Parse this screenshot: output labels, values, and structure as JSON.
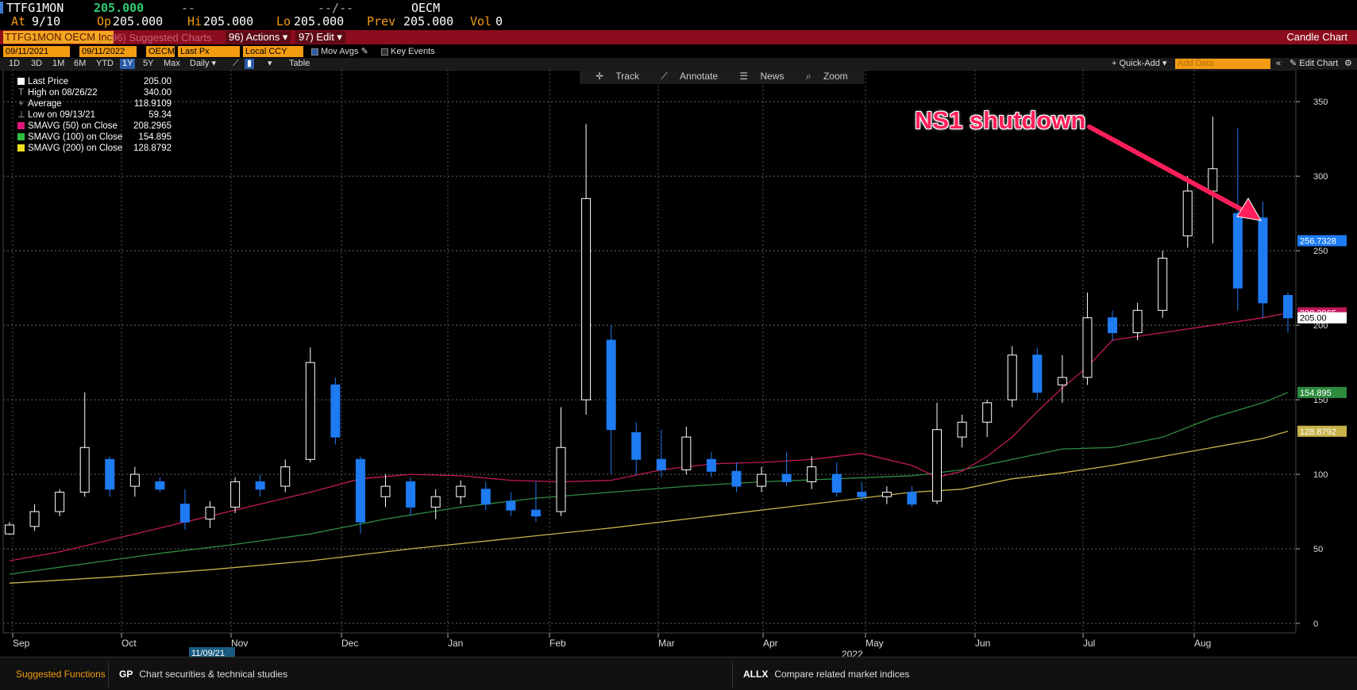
{
  "quote": {
    "ticker": "TTFG1MON",
    "last": "205.000",
    "change": "--",
    "change_pct": "--/--",
    "exchange": "OECM",
    "at_label": "At",
    "at_value": "9/10",
    "op_label": "Op",
    "op_value": "205.000",
    "hi_label": "Hi",
    "hi_value": "205.000",
    "lo_label": "Lo",
    "lo_value": "205.000",
    "prev_label": "Prev",
    "prev_value": "205.000",
    "vol_label": "Vol",
    "vol_value": "0"
  },
  "toolbar": {
    "security": "TTFG1MON OECM Inc",
    "suggested": "96) Suggested Charts",
    "actions": "96) Actions ▾",
    "edit": "97) Edit ▾",
    "chart_type": "Candle Chart"
  },
  "controls": {
    "start_date": "09/11/2021",
    "end_date": "09/11/2022",
    "source": "OECM",
    "field": "Last Px",
    "currency": "Local CCY",
    "mov_avgs": "Mov Avgs",
    "key_events": "Key Events"
  },
  "ranges": [
    "1D",
    "3D",
    "1M",
    "6M",
    "YTD",
    "1Y",
    "5Y",
    "Max"
  ],
  "active_range": "1Y",
  "period": "Daily ▾",
  "table_label": "Table",
  "quick_add": "+ Quick-Add ▾",
  "add_data_placeholder": "Add Data",
  "edit_chart": "Edit Chart",
  "tools": [
    "Track",
    "Annotate",
    "News",
    "Zoom"
  ],
  "legend": [
    {
      "label": "Last Price",
      "value": "205.00",
      "swatch": "#ffffff"
    },
    {
      "label": "High on 08/26/22",
      "value": "340.00",
      "icon": "T"
    },
    {
      "label": "Average",
      "value": "118.9109",
      "icon": "+"
    },
    {
      "label": "Low on 09/13/21",
      "value": "59.34",
      "icon": "⊥"
    },
    {
      "label": "SMAVG (50)   on Close",
      "value": "208.2965",
      "swatch": "#e0177d"
    },
    {
      "label": "SMAVG (100)  on Close",
      "value": "154.895",
      "swatch": "#2ebd3f"
    },
    {
      "label": "SMAVG (200)  on Close",
      "value": "128.8792",
      "swatch": "#f0e020"
    }
  ],
  "annotation": "NS1 shutdown",
  "bottom": {
    "suggested_functions": "Suggested Functions",
    "gp_tag": "GP",
    "gp_desc": "Chart securities & technical studies",
    "allx_tag": "ALLX",
    "allx_desc": "Compare related market indices"
  },
  "colors": {
    "up": "#ffffff",
    "down": "#1e7bf2",
    "sma50": "#c2185b",
    "sma100": "#2e8b3e",
    "sma200": "#c9b24a",
    "accent_amber": "#f39c12",
    "toolbar_red": "#8c0d1d"
  },
  "chart_data": {
    "type": "candlestick",
    "title": "",
    "y_axis": {
      "ticks": [
        0,
        50,
        100,
        150,
        200,
        250,
        300,
        350
      ],
      "range": [
        0,
        365
      ],
      "side": "right",
      "grid": true
    },
    "x_axis": {
      "months": [
        "Sep",
        "Oct",
        "Nov",
        "Dec",
        "Jan",
        "Feb",
        "Mar",
        "Apr",
        "May",
        "Jun",
        "Jul",
        "Aug"
      ],
      "year_label": "2022",
      "cursor_date": "11/09/21"
    },
    "price_tags": [
      {
        "value": 256.7328,
        "label": "256.7328",
        "color": "#1e7bf2"
      },
      {
        "value": 208.2965,
        "label": "208.2965",
        "color": "#c2185b"
      },
      {
        "value": 205.0,
        "label": "205.00",
        "color": "#ffffff"
      },
      {
        "value": 154.895,
        "label": "154.895",
        "color": "#2e8b3e"
      },
      {
        "value": 128.8792,
        "label": "128.8792",
        "color": "#c9b24a"
      }
    ],
    "candles": [
      {
        "d": "2021-09-13",
        "o": 60,
        "h": 68,
        "l": 59.34,
        "c": 66
      },
      {
        "d": "2021-09-20",
        "o": 65,
        "h": 80,
        "l": 62,
        "c": 75
      },
      {
        "d": "2021-09-27",
        "o": 75,
        "h": 90,
        "l": 72,
        "c": 88
      },
      {
        "d": "2021-10-04",
        "o": 88,
        "h": 155,
        "l": 85,
        "c": 118
      },
      {
        "d": "2021-10-11",
        "o": 110,
        "h": 112,
        "l": 85,
        "c": 90
      },
      {
        "d": "2021-10-18",
        "o": 92,
        "h": 105,
        "l": 85,
        "c": 100
      },
      {
        "d": "2021-10-25",
        "o": 95,
        "h": 98,
        "l": 88,
        "c": 90
      },
      {
        "d": "2021-11-01",
        "o": 80,
        "h": 90,
        "l": 63,
        "c": 68
      },
      {
        "d": "2021-11-08",
        "o": 70,
        "h": 82,
        "l": 64,
        "c": 78
      },
      {
        "d": "2021-11-15",
        "o": 78,
        "h": 98,
        "l": 74,
        "c": 95
      },
      {
        "d": "2021-11-22",
        "o": 95,
        "h": 100,
        "l": 85,
        "c": 90
      },
      {
        "d": "2021-11-29",
        "o": 92,
        "h": 110,
        "l": 88,
        "c": 105
      },
      {
        "d": "2021-12-06",
        "o": 110,
        "h": 185,
        "l": 108,
        "c": 175
      },
      {
        "d": "2021-12-13",
        "o": 160,
        "h": 165,
        "l": 120,
        "c": 125
      },
      {
        "d": "2021-12-20",
        "o": 110,
        "h": 112,
        "l": 60,
        "c": 68
      },
      {
        "d": "2021-12-27",
        "o": 85,
        "h": 100,
        "l": 78,
        "c": 92
      },
      {
        "d": "2022-01-03",
        "o": 95,
        "h": 98,
        "l": 72,
        "c": 78
      },
      {
        "d": "2022-01-10",
        "o": 78,
        "h": 90,
        "l": 70,
        "c": 85
      },
      {
        "d": "2022-01-17",
        "o": 85,
        "h": 96,
        "l": 80,
        "c": 92
      },
      {
        "d": "2022-01-24",
        "o": 90,
        "h": 95,
        "l": 76,
        "c": 80
      },
      {
        "d": "2022-01-31",
        "o": 82,
        "h": 88,
        "l": 72,
        "c": 76
      },
      {
        "d": "2022-02-07",
        "o": 76,
        "h": 95,
        "l": 68,
        "c": 72
      },
      {
        "d": "2022-02-14",
        "o": 75,
        "h": 145,
        "l": 72,
        "c": 118
      },
      {
        "d": "2022-02-21",
        "o": 150,
        "h": 335,
        "l": 140,
        "c": 285
      },
      {
        "d": "2022-02-28",
        "o": 190,
        "h": 200,
        "l": 100,
        "c": 130
      },
      {
        "d": "2022-03-07",
        "o": 128,
        "h": 135,
        "l": 100,
        "c": 110
      },
      {
        "d": "2022-03-14",
        "o": 110,
        "h": 130,
        "l": 98,
        "c": 103
      },
      {
        "d": "2022-03-21",
        "o": 103,
        "h": 132,
        "l": 100,
        "c": 125
      },
      {
        "d": "2022-03-28",
        "o": 110,
        "h": 115,
        "l": 98,
        "c": 102
      },
      {
        "d": "2022-04-04",
        "o": 102,
        "h": 108,
        "l": 88,
        "c": 92
      },
      {
        "d": "2022-04-11",
        "o": 92,
        "h": 105,
        "l": 88,
        "c": 100
      },
      {
        "d": "2022-04-18",
        "o": 100,
        "h": 115,
        "l": 92,
        "c": 95
      },
      {
        "d": "2022-04-25",
        "o": 95,
        "h": 112,
        "l": 90,
        "c": 105
      },
      {
        "d": "2022-05-02",
        "o": 100,
        "h": 108,
        "l": 85,
        "c": 88
      },
      {
        "d": "2022-05-09",
        "o": 88,
        "h": 95,
        "l": 82,
        "c": 85
      },
      {
        "d": "2022-05-16",
        "o": 85,
        "h": 92,
        "l": 80,
        "c": 88
      },
      {
        "d": "2022-05-23",
        "o": 88,
        "h": 92,
        "l": 78,
        "c": 80
      },
      {
        "d": "2022-05-30",
        "o": 82,
        "h": 148,
        "l": 80,
        "c": 130
      },
      {
        "d": "2022-06-06",
        "o": 125,
        "h": 140,
        "l": 118,
        "c": 135
      },
      {
        "d": "2022-06-13",
        "o": 135,
        "h": 150,
        "l": 125,
        "c": 148
      },
      {
        "d": "2022-06-20",
        "o": 150,
        "h": 186,
        "l": 145,
        "c": 180
      },
      {
        "d": "2022-06-27",
        "o": 180,
        "h": 185,
        "l": 150,
        "c": 155
      },
      {
        "d": "2022-07-04",
        "o": 160,
        "h": 180,
        "l": 148,
        "c": 165
      },
      {
        "d": "2022-07-11",
        "o": 165,
        "h": 222,
        "l": 160,
        "c": 205
      },
      {
        "d": "2022-07-18",
        "o": 205,
        "h": 210,
        "l": 190,
        "c": 195
      },
      {
        "d": "2022-07-25",
        "o": 195,
        "h": 215,
        "l": 190,
        "c": 210
      },
      {
        "d": "2022-08-01",
        "o": 210,
        "h": 250,
        "l": 205,
        "c": 245
      },
      {
        "d": "2022-08-08",
        "o": 260,
        "h": 300,
        "l": 252,
        "c": 290
      },
      {
        "d": "2022-08-15",
        "o": 290,
        "h": 340,
        "l": 255,
        "c": 305
      },
      {
        "d": "2022-08-22",
        "o": 275,
        "h": 332,
        "l": 210,
        "c": 225
      },
      {
        "d": "2022-08-29",
        "o": 272,
        "h": 283,
        "l": 205,
        "c": 215
      },
      {
        "d": "2022-09-05",
        "o": 220,
        "h": 222,
        "l": 195,
        "c": 205
      }
    ],
    "sma50": [
      [
        0,
        42
      ],
      [
        2,
        48
      ],
      [
        4,
        56
      ],
      [
        6,
        64
      ],
      [
        8,
        72
      ],
      [
        10,
        80
      ],
      [
        12,
        88
      ],
      [
        14,
        97
      ],
      [
        16,
        100
      ],
      [
        18,
        99
      ],
      [
        20,
        96
      ],
      [
        22,
        95
      ],
      [
        24,
        96
      ],
      [
        26,
        103
      ],
      [
        28,
        107
      ],
      [
        30,
        108
      ],
      [
        32,
        110
      ],
      [
        34,
        114
      ],
      [
        36,
        106
      ],
      [
        37,
        98
      ],
      [
        38,
        102
      ],
      [
        39,
        112
      ],
      [
        40,
        125
      ],
      [
        41,
        142
      ],
      [
        42,
        158
      ],
      [
        43,
        172
      ],
      [
        44,
        190
      ],
      [
        46,
        195
      ],
      [
        48,
        200
      ],
      [
        50,
        205
      ],
      [
        51,
        208.2965
      ]
    ],
    "sma100": [
      [
        0,
        33
      ],
      [
        3,
        40
      ],
      [
        6,
        47
      ],
      [
        9,
        53
      ],
      [
        12,
        60
      ],
      [
        15,
        70
      ],
      [
        18,
        78
      ],
      [
        21,
        84
      ],
      [
        24,
        88
      ],
      [
        27,
        92
      ],
      [
        30,
        95
      ],
      [
        33,
        97
      ],
      [
        36,
        99
      ],
      [
        38,
        103
      ],
      [
        40,
        110
      ],
      [
        42,
        117
      ],
      [
        44,
        118
      ],
      [
        46,
        125
      ],
      [
        48,
        138
      ],
      [
        50,
        148
      ],
      [
        51,
        154.895
      ]
    ],
    "sma200": [
      [
        0,
        27
      ],
      [
        4,
        31
      ],
      [
        8,
        36
      ],
      [
        12,
        42
      ],
      [
        16,
        50
      ],
      [
        20,
        57
      ],
      [
        24,
        64
      ],
      [
        28,
        72
      ],
      [
        32,
        80
      ],
      [
        36,
        88
      ],
      [
        38,
        90
      ],
      [
        40,
        97
      ],
      [
        42,
        101
      ],
      [
        44,
        106
      ],
      [
        46,
        112
      ],
      [
        48,
        118
      ],
      [
        50,
        124
      ],
      [
        51,
        128.8792
      ]
    ]
  }
}
